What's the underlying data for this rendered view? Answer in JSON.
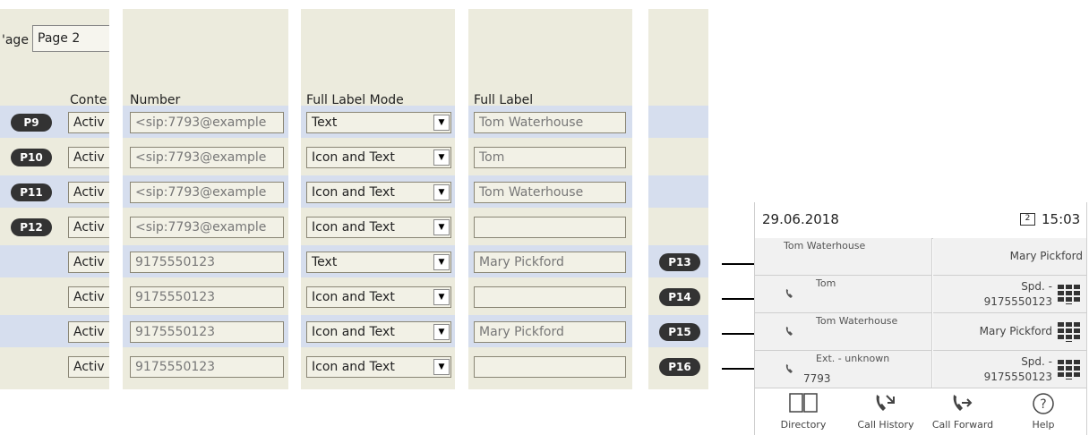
{
  "panel1": {
    "page_label_prefix": "'age",
    "page_tab": "Page 2",
    "content_header": "Conte",
    "rows": [
      {
        "key": "P9",
        "content": "Activ"
      },
      {
        "key": "P10",
        "content": "Activ"
      },
      {
        "key": "P11",
        "content": "Activ"
      },
      {
        "key": "P12",
        "content": "Activ"
      },
      {
        "key": "",
        "content": "Activ"
      },
      {
        "key": "",
        "content": "Activ"
      },
      {
        "key": "",
        "content": "Activ"
      },
      {
        "key": "",
        "content": "Activ"
      }
    ]
  },
  "panel2": {
    "header": "Number",
    "values": [
      "<sip:7793@example",
      "<sip:7793@example",
      "<sip:7793@example",
      "<sip:7793@example",
      "9175550123",
      "9175550123",
      "9175550123",
      "9175550123"
    ]
  },
  "panel3": {
    "header": "Full Label Mode",
    "values": [
      "Text",
      "Icon and Text",
      "Icon and Text",
      "Icon and Text",
      "Text",
      "Icon and Text",
      "Icon and Text",
      "Icon and Text"
    ]
  },
  "panel4": {
    "header": "Full Label",
    "values": [
      "Tom Waterhouse",
      "Tom",
      "Tom Waterhouse",
      "",
      "Mary Pickford",
      "",
      "Mary Pickford",
      ""
    ]
  },
  "panel5": {
    "keys": [
      "",
      "",
      "",
      "",
      "P13",
      "P14",
      "P15",
      "P16"
    ]
  },
  "phone": {
    "date": "29.06.2018",
    "time": "15:03",
    "line_badge": "2",
    "left": [
      {
        "line1": "Tom Waterhouse",
        "line2": ""
      },
      {
        "line1": "Tom",
        "line2": ""
      },
      {
        "line1": "Tom Waterhouse",
        "line2": ""
      },
      {
        "line1": "Ext. - unknown",
        "line2": "7793"
      }
    ],
    "right": [
      {
        "line1": "Mary Pickford",
        "line2": ""
      },
      {
        "line1": "Spd. -",
        "line2": "9175550123"
      },
      {
        "line1": "Mary Pickford",
        "line2": ""
      },
      {
        "line1": "Spd. -",
        "line2": "9175550123"
      }
    ],
    "softkeys": [
      {
        "label": "Directory",
        "icon": "book-icon"
      },
      {
        "label": "Call History",
        "icon": "call-history-icon"
      },
      {
        "label": "Call Forward",
        "icon": "call-forward-icon"
      },
      {
        "label": "Help",
        "icon": "help-icon"
      }
    ]
  },
  "colors": {
    "panel_bg": "#ecebdd",
    "row_band": "#d6deee",
    "badge": "#333333"
  }
}
